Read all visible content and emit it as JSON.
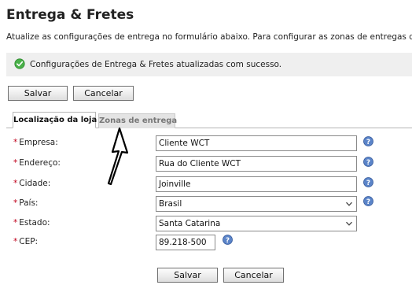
{
  "page": {
    "title": "Entrega & Fretes",
    "intro": "Atualize as configurações de entrega no formulário abaixo. Para configurar as zonas de entregas disponíveis"
  },
  "alert": {
    "icon": "check-circle-icon",
    "message": "Configurações de Entrega & Fretes atualizadas com sucesso.",
    "color": "#2e9d2e"
  },
  "toolbar": {
    "save_label": "Salvar",
    "cancel_label": "Cancelar"
  },
  "tabs": [
    {
      "label": "Localização da loja",
      "active": true
    },
    {
      "label": "Zonas de entrega",
      "active": false
    }
  ],
  "form": {
    "required_marker": "*",
    "fields": {
      "company": {
        "label": "Empresa:",
        "value": "Cliente WCT"
      },
      "address": {
        "label": "Endereço:",
        "value": "Rua do Cliente WCT"
      },
      "city": {
        "label": "Cidade:",
        "value": "Joinville"
      },
      "country": {
        "label": "País:",
        "value": "Brasil"
      },
      "state": {
        "label": "Estado:",
        "value": "Santa Catarina"
      },
      "zip": {
        "label": "CEP:",
        "value": "89.218-500"
      }
    }
  },
  "icons": {
    "help": "help-icon",
    "help_color": "#4a73b8"
  }
}
